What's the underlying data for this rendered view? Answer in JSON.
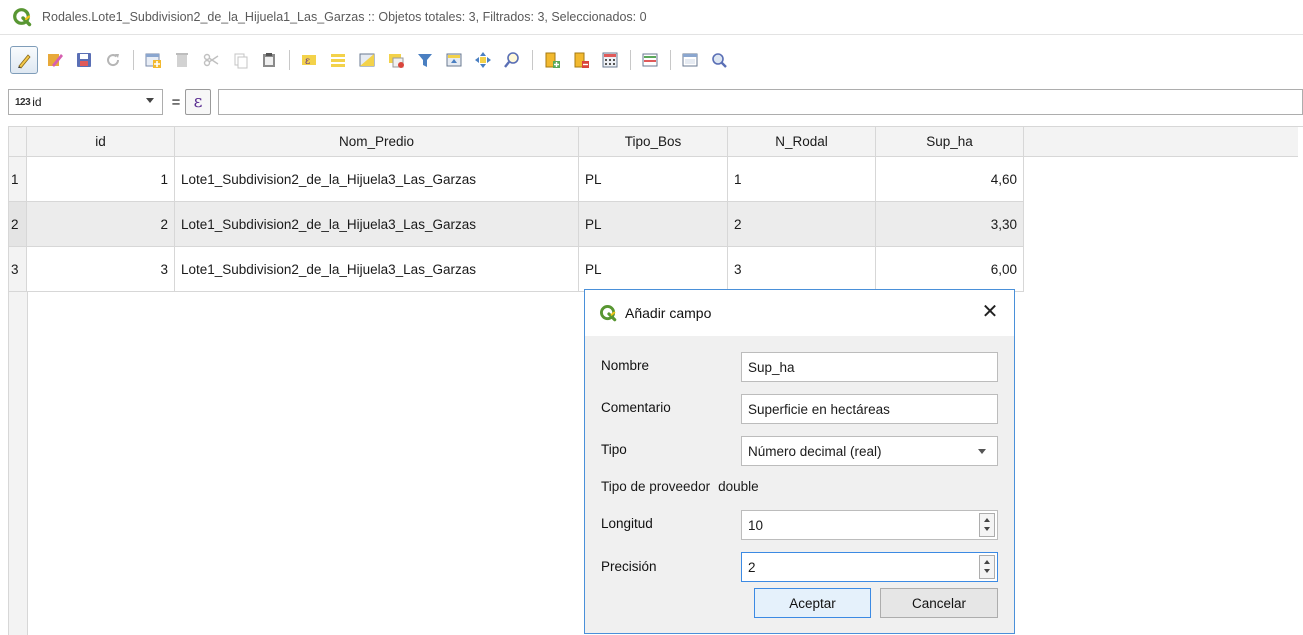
{
  "window": {
    "title": "Rodales.Lote1_Subdivision2_de_la_Hijuela1_Las_Garzas :: Objetos totales: 3, Filtrados: 3, Seleccionados: 0",
    "logo_color": "#589632"
  },
  "toolbar": {
    "buttons": [
      "toggle-editing-icon",
      "multi-edit-icon",
      "save-edits-icon",
      "reload-icon",
      "add-feature-icon",
      "delete-feature-icon",
      "cut-icon",
      "copy-icon",
      "paste-icon",
      "expression-select-icon",
      "select-all-icon",
      "invert-selection-icon",
      "deselect-all-icon",
      "filter-selection-icon",
      "move-selection-top-icon",
      "pan-to-selected-icon",
      "zoom-to-selected-icon",
      "new-field-icon",
      "delete-field-icon",
      "field-calculator-icon",
      "conditional-formatting-icon",
      "dock-table-icon",
      "actions-icon"
    ]
  },
  "expression_bar": {
    "field_type": "123",
    "field_name": "id",
    "operator": "=",
    "epsilon": "ε",
    "expression": ""
  },
  "table": {
    "columns": [
      "id",
      "Nom_Predio",
      "Tipo_Bos",
      "N_Rodal",
      "Sup_ha"
    ],
    "rows": [
      {
        "row_header": "1",
        "id": "1",
        "Nom_Predio": "Lote1_Subdivision2_de_la_Hijuela3_Las_Garzas",
        "Tipo_Bos": "PL",
        "N_Rodal": "1",
        "Sup_ha": "4,60"
      },
      {
        "row_header": "2",
        "id": "2",
        "Nom_Predio": "Lote1_Subdivision2_de_la_Hijuela3_Las_Garzas",
        "Tipo_Bos": "PL",
        "N_Rodal": "2",
        "Sup_ha": "3,30"
      },
      {
        "row_header": "3",
        "id": "3",
        "Nom_Predio": "Lote1_Subdivision2_de_la_Hijuela3_Las_Garzas",
        "Tipo_Bos": "PL",
        "N_Rodal": "3",
        "Sup_ha": "6,00"
      }
    ]
  },
  "dialog": {
    "title": "Añadir campo",
    "close": "✕",
    "nombre_label": "Nombre",
    "nombre_value": "Sup_ha",
    "comentario_label": "Comentario",
    "comentario_value": "Superficie en hectáreas",
    "tipo_label": "Tipo",
    "tipo_value": "Número decimal (real)",
    "proveedor_label": "Tipo de proveedor",
    "proveedor_value": "double",
    "longitud_label": "Longitud",
    "longitud_value": "10",
    "precision_label": "Precisión",
    "precision_value": "2",
    "ok_label": "Aceptar",
    "cancel_label": "Cancelar"
  }
}
